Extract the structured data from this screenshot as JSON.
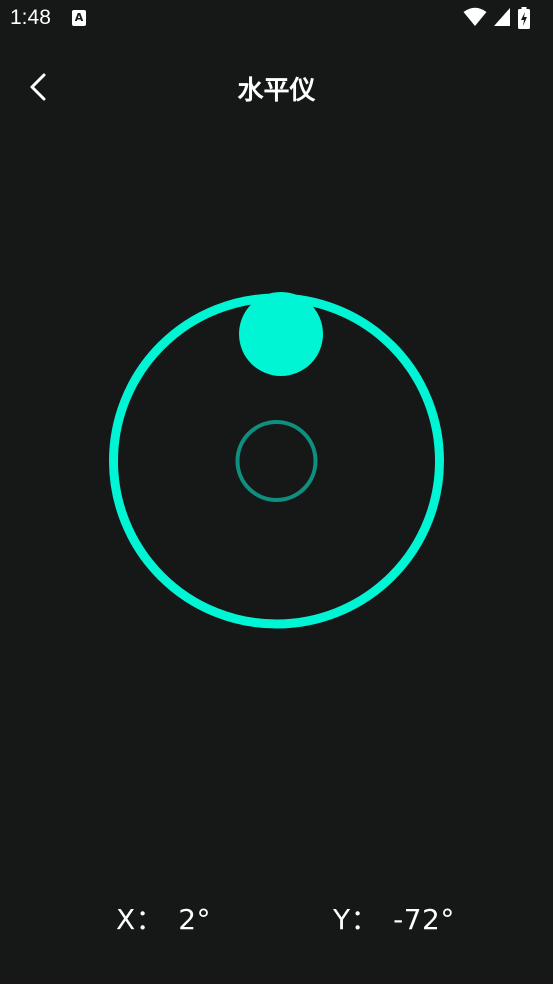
{
  "status_bar": {
    "time": "1:48",
    "notification_icon_letter": "A",
    "icons": [
      "wifi-icon",
      "signal-icon",
      "battery-charging-icon"
    ]
  },
  "header": {
    "title": "水平仪",
    "back_icon": "chevron-left-icon"
  },
  "level": {
    "ring_color": "#00f5d4",
    "bubble_color": "#00f5d4",
    "center_target_color": "#0e8f80",
    "background": "#161818",
    "x_angle_deg": 2,
    "y_angle_deg": -72
  },
  "readouts": {
    "x_label": "X：",
    "x_value": "2°",
    "y_label": "Y：",
    "y_value": "-72°"
  }
}
